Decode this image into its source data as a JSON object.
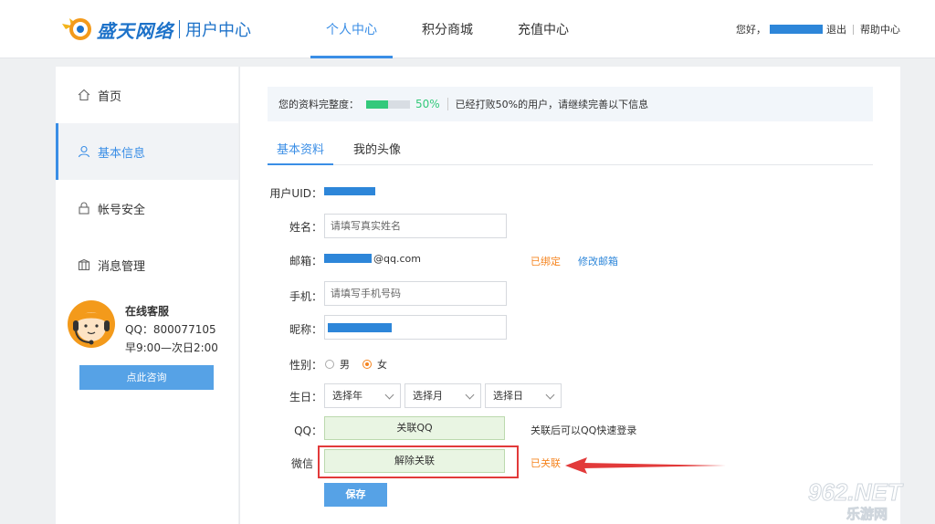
{
  "header": {
    "brand": "盛天网络",
    "subtitle": "用户中心",
    "nav": [
      "个人中心",
      "积分商城",
      "充值中心"
    ],
    "greeting": "您好，",
    "logout": "退出",
    "help": "帮助中心"
  },
  "sidebar": {
    "items": [
      {
        "label": "首页",
        "icon": "home-icon"
      },
      {
        "label": "基本信息",
        "icon": "user-icon"
      },
      {
        "label": "帐号安全",
        "icon": "lock-icon"
      },
      {
        "label": "消息管理",
        "icon": "message-icon"
      }
    ],
    "service": {
      "title": "在线客服",
      "qq": "QQ：800077105",
      "hours": "早9:00—次日2:00",
      "button": "点此咨询"
    }
  },
  "profile": {
    "completeness_label": "您的资料完整度：",
    "completeness_percent": "50%",
    "completeness_value": 0.5,
    "completeness_note": "已经打败50%的用户，请继续完善以下信息"
  },
  "tabs": [
    "基本资料",
    "我的头像"
  ],
  "form": {
    "uid_label": "用户UID：",
    "name_label": "姓名：",
    "name_placeholder": "请填写真实姓名",
    "email_label": "邮箱：",
    "email_suffix": "@qq.com",
    "email_status": "已绑定",
    "email_modify": "修改邮箱",
    "phone_label": "手机：",
    "phone_placeholder": "请填写手机号码",
    "nickname_label": "昵称：",
    "gender_label": "性别：",
    "gender_male": "男",
    "gender_female": "女",
    "birthday_label": "生日：",
    "year_select": "选择年",
    "month_select": "选择月",
    "day_select": "选择日",
    "qq_label": "QQ：",
    "qq_button": "关联QQ",
    "qq_note": "关联后可以QQ快速登录",
    "wechat_label": "微信",
    "wechat_button": "解除关联",
    "wechat_status": "已关联",
    "save_button": "保存"
  },
  "watermark": {
    "top": "962.NET",
    "bottom": "乐游网"
  },
  "colors": {
    "accent": "#3a8ee6",
    "orange": "#f5841f",
    "green": "#34c97b",
    "highlight": "#e23a3a"
  }
}
